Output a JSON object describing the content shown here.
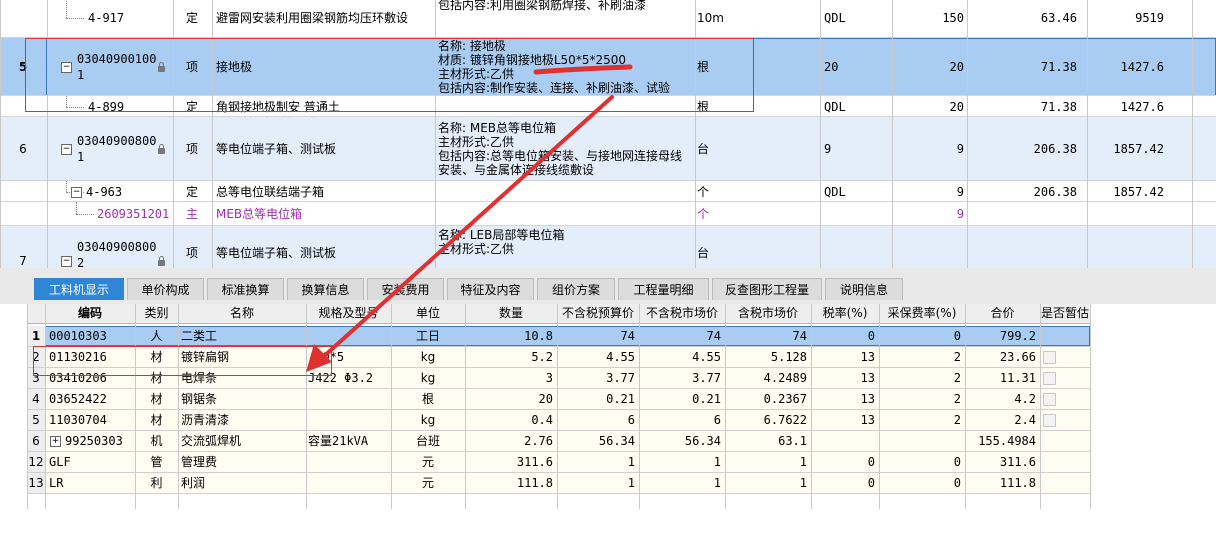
{
  "upper_rows": [
    {
      "row_no": "",
      "code": "4-917",
      "type": "定",
      "name": "避雷网安装利用圈梁钢筋均压环敷设",
      "desc": [
        "包括内容:利用圈梁钢筋焊接、补刷油漆"
      ],
      "unit": "10m",
      "qty_expr": "QDL",
      "qty": "150",
      "price": "63.46",
      "total": "9519",
      "level": "sub"
    },
    {
      "row_no": "5",
      "code": "030409001001",
      "type": "项",
      "name": "接地极",
      "desc": [
        "名称:  接地极",
        "材质: 镀锌角钢接地极L50*5*2500",
        "主材形式:乙供",
        "包括内容:制作安装、连接、补刷油漆、试验"
      ],
      "unit": "根",
      "qty_expr": "20",
      "qty": "20",
      "price": "71.38",
      "total": "1427.6",
      "level": "item",
      "selected": true
    },
    {
      "row_no": "",
      "code": "4-899",
      "type": "定",
      "name": "角钢接地极制安 普通土",
      "desc": [],
      "unit": "根",
      "qty_expr": "QDL",
      "qty": "20",
      "price": "71.38",
      "total": "1427.6",
      "level": "sub"
    },
    {
      "row_no": "6",
      "code": "030409008001",
      "type": "项",
      "name": "等电位端子箱、测试板",
      "desc": [
        "名称:  MEB总等电位箱",
        "主材形式:乙供",
        "包括内容:总等电位箱安装、与接地网连接母线",
        "安装、与金属体连接线缆敷设"
      ],
      "unit": "台",
      "qty_expr": "9",
      "qty": "9",
      "price": "206.38",
      "total": "1857.42",
      "level": "item"
    },
    {
      "row_no": "",
      "code": "4-963",
      "type": "定",
      "name": "总等电位联结端子箱",
      "desc": [],
      "unit": "个",
      "qty_expr": "QDL",
      "qty": "9",
      "price": "206.38",
      "total": "1857.42",
      "level": "sub"
    },
    {
      "row_no": "",
      "code": "2609351201",
      "type": "主",
      "name": "MEB总等电位箱",
      "desc": [],
      "unit": "个",
      "qty_expr": "",
      "qty": "9",
      "price": "",
      "total": "",
      "level": "main"
    },
    {
      "row_no": "7",
      "code": "030409008002",
      "type": "项",
      "name": "等电位端子箱、测试板",
      "desc": [
        "名称:  LEB局部等电位箱",
        "主材形式:乙供"
      ],
      "unit": "台",
      "qty_expr": "",
      "qty": "",
      "price": "",
      "total": "",
      "level": "item"
    }
  ],
  "tabs": [
    "工料机显示",
    "单价构成",
    "标准换算",
    "换算信息",
    "安装费用",
    "特征及内容",
    "组价方案",
    "工程量明细",
    "反查图形工程量",
    "说明信息"
  ],
  "active_tab": "工料机显示",
  "grid_headers": [
    "编码",
    "类别",
    "名称",
    "规格及型号",
    "单位",
    "数量",
    "不含税预算价",
    "不含税市场价",
    "含税市场价",
    "税率(%)",
    "采保费率(%)",
    "合价",
    "是否暂估"
  ],
  "grid_rows": [
    {
      "no": "1",
      "code": "00010303",
      "cat": "人",
      "name": "二类工",
      "spec": "",
      "unit": "工日",
      "qty": "10.8",
      "budget": "74",
      "market": "74",
      "tax_market": "74",
      "tax_rate": "0",
      "fee_rate": "0",
      "total": "799.2",
      "checkbox": false,
      "selected": true
    },
    {
      "no": "2",
      "code": "01130216",
      "cat": "材",
      "name": "镀锌扁钢",
      "spec": "-60*5",
      "unit": "kg",
      "qty": "5.2",
      "budget": "4.55",
      "market": "4.55",
      "tax_market": "5.128",
      "tax_rate": "13",
      "fee_rate": "2",
      "total": "23.66",
      "checkbox": true
    },
    {
      "no": "3",
      "code": "03410206",
      "cat": "材",
      "name": "电焊条",
      "spec": "J422 Φ3.2",
      "unit": "kg",
      "qty": "3",
      "budget": "3.77",
      "market": "3.77",
      "tax_market": "4.2489",
      "tax_rate": "13",
      "fee_rate": "2",
      "total": "11.31",
      "checkbox": true
    },
    {
      "no": "4",
      "code": "03652422",
      "cat": "材",
      "name": "钢锯条",
      "spec": "",
      "unit": "根",
      "qty": "20",
      "budget": "0.21",
      "market": "0.21",
      "tax_market": "0.2367",
      "tax_rate": "13",
      "fee_rate": "2",
      "total": "4.2",
      "checkbox": true
    },
    {
      "no": "5",
      "code": "11030704",
      "cat": "材",
      "name": "沥青清漆",
      "spec": "",
      "unit": "kg",
      "qty": "0.4",
      "budget": "6",
      "market": "6",
      "tax_market": "6.7622",
      "tax_rate": "13",
      "fee_rate": "2",
      "total": "2.4",
      "checkbox": true
    },
    {
      "no": "6",
      "code": "99250303",
      "cat": "机",
      "name": "交流弧焊机",
      "spec": "容量21kVA",
      "unit": "台班",
      "qty": "2.76",
      "budget": "56.34",
      "market": "56.34",
      "tax_market": "63.1",
      "tax_rate": "",
      "fee_rate": "",
      "total": "155.4984",
      "checkbox": false,
      "expand": true
    },
    {
      "no": "12",
      "code": "GLF",
      "cat": "管",
      "name": "管理费",
      "spec": "",
      "unit": "元",
      "qty": "311.6",
      "budget": "1",
      "market": "1",
      "tax_market": "1",
      "tax_rate": "0",
      "fee_rate": "0",
      "total": "311.6",
      "checkbox": false
    },
    {
      "no": "13",
      "code": "LR",
      "cat": "利",
      "name": "利润",
      "spec": "",
      "unit": "元",
      "qty": "111.8",
      "budget": "1",
      "market": "1",
      "tax_market": "1",
      "tax_rate": "0",
      "fee_rate": "0",
      "total": "111.8",
      "checkbox": false
    }
  ],
  "colors": {
    "selected_row": "#a9cdf2",
    "item_row": "#e4eefb",
    "sub_row": "#ffffff",
    "main_text": "#9b2fae",
    "tab_active": "#2f86d6",
    "annotation_red": "#e03030"
  }
}
